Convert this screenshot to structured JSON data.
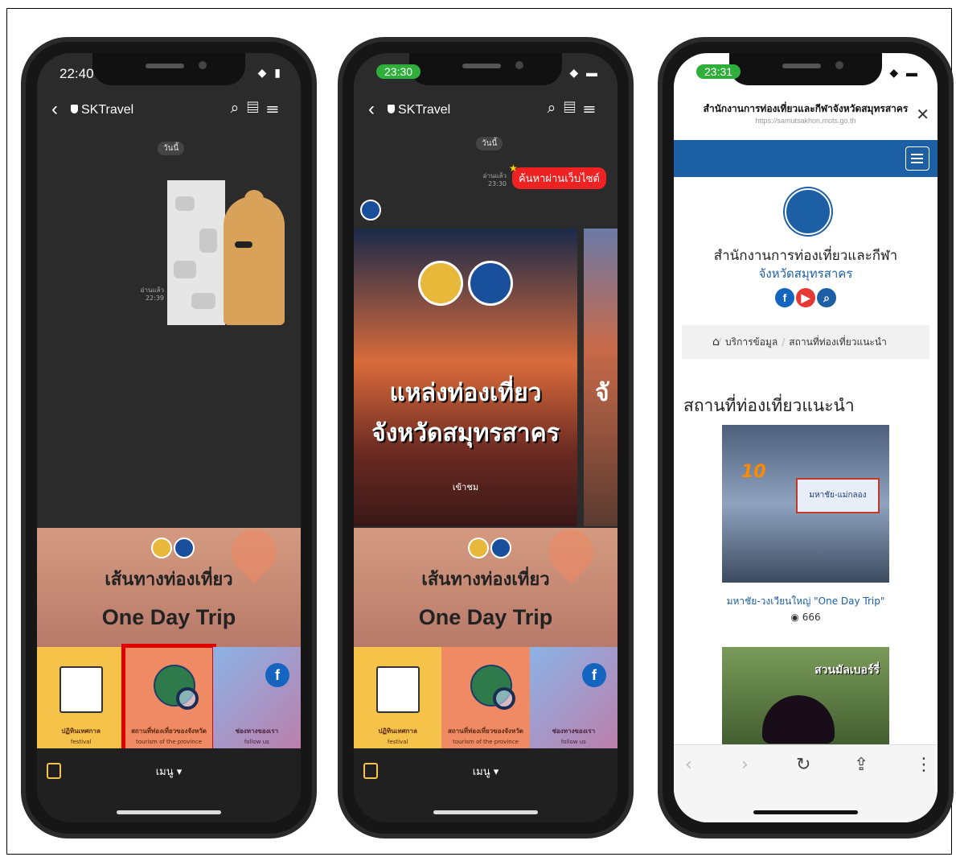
{
  "phones": [
    {
      "time": "22:40",
      "chat_title": "SKTravel",
      "day_label": "วันนี้",
      "read_label": "อ่านแล้ว",
      "read_time": "22:39",
      "rich_title": "เส้นทางท่องเที่ยว",
      "rich_subtitle": "One Day Trip",
      "tiles": [
        {
          "label": "ปฏิทินเทศกาล",
          "sub": "festival"
        },
        {
          "label": "สถานที่ท่องเที่ยวของจังหวัด",
          "sub": "tourism of the province"
        },
        {
          "label": "ช่องทางของเรา",
          "sub": "follow us"
        }
      ],
      "menu_label": "เมนู ▾",
      "highlighted_tile": 2
    },
    {
      "time": "23:30",
      "chat_title": "SKTravel",
      "day_label": "วันนี้",
      "read_label": "อ่านแล้ว",
      "read_time": "23:30",
      "search_button": "ค้นหาผ่านเว็บไซต์",
      "card_title_line1": "แหล่งท่องเที่ยว",
      "card_title_line2": "จังหวัดสมุทรสาคร",
      "card_button": "เข้าชม",
      "peek_char": "จั",
      "rich_title": "เส้นทางท่องเที่ยว",
      "rich_subtitle": "One Day Trip",
      "tiles": [
        {
          "label": "ปฏิทินเทศกาล",
          "sub": "festival"
        },
        {
          "label": "สถานที่ท่องเที่ยวของจังหวัด",
          "sub": "tourism of the province"
        },
        {
          "label": "ช่องทางของเรา",
          "sub": "follow us"
        }
      ],
      "menu_label": "เมนู ▾"
    },
    {
      "time": "23:31",
      "browser_title": "สำนักงานการท่องเที่ยวและกีฬาจังหวัดสมุทรสาคร",
      "browser_url": "https://samutsakhon.mots.go.th",
      "org_name": "สำนักงานการท่องเที่ยวและกีฬา",
      "org_province": "จังหวัดสมุทรสาคร",
      "breadcrumb": [
        "บริการข้อมูล",
        "สถานที่ท่องเที่ยวแนะนำ"
      ],
      "section_heading": "สถานที่ท่องเที่ยวแนะนำ",
      "photo1_badge": "10",
      "photo1_sign": "มหาชัย-แม่กลอง",
      "photo1_caption": "มหาชัย-วงเวียนใหญ่ \"One Day Trip\"",
      "photo1_views": "666",
      "photo2_text": "สวนมัลเบอร์รี่"
    }
  ],
  "colors": {
    "line_green": "#2fae3b",
    "site_blue": "#1d5fa5",
    "highlight_red": "#e00000"
  }
}
